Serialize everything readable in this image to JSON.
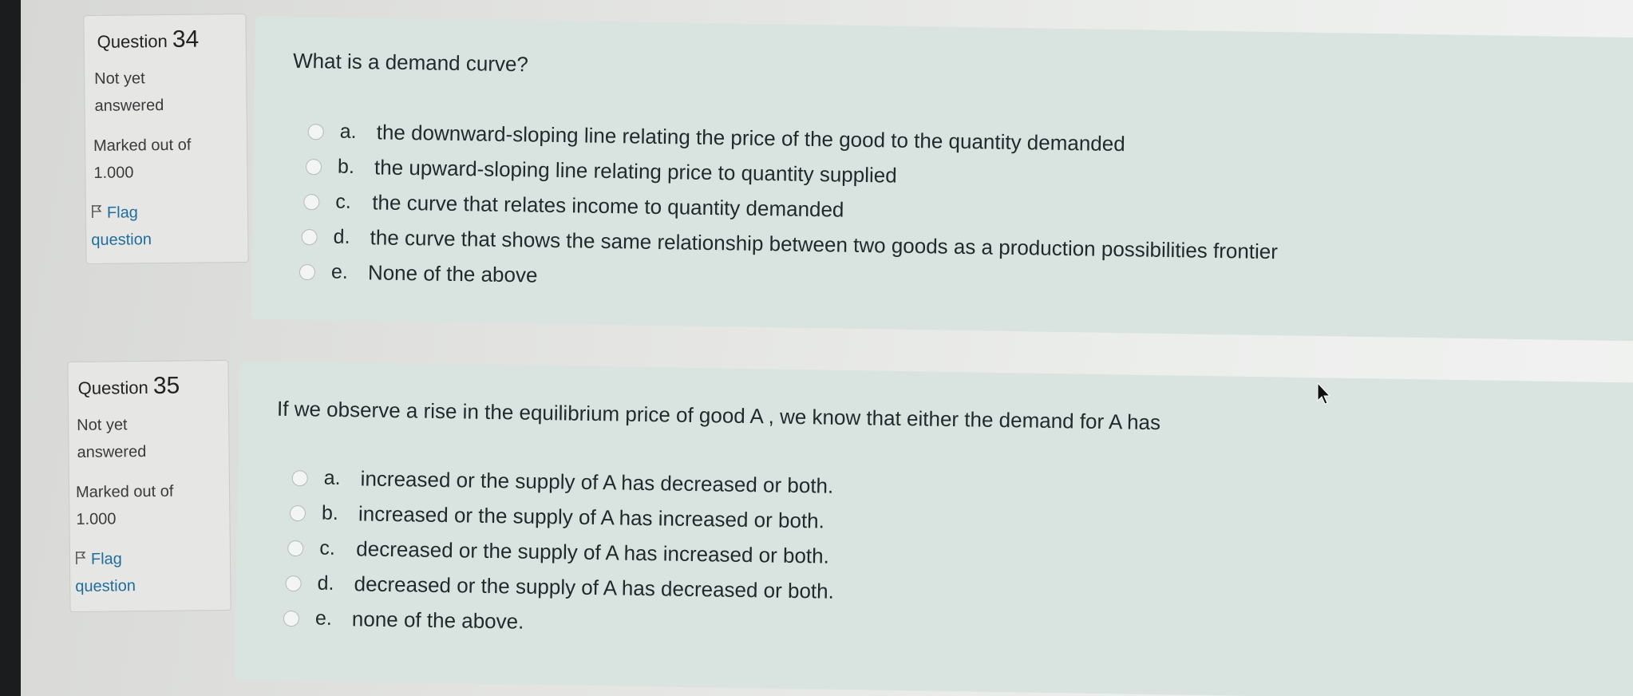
{
  "questions": [
    {
      "label": "Question",
      "number": "34",
      "status": [
        "Not yet",
        "answered"
      ],
      "marks": [
        "Marked out of",
        "1.000"
      ],
      "flag": [
        "Flag",
        "question"
      ],
      "text": "What is a demand curve?",
      "options": [
        {
          "letter": "a.",
          "text": "the downward-sloping line relating the price of the good to the quantity demanded"
        },
        {
          "letter": "b.",
          "text": "the upward-sloping line relating price to quantity supplied"
        },
        {
          "letter": "c.",
          "text": "the curve that relates income to quantity demanded"
        },
        {
          "letter": "d.",
          "text": "the curve that shows the same relationship between two goods as a production possibilities frontier"
        },
        {
          "letter": "e.",
          "text": "None of the above"
        }
      ]
    },
    {
      "label": "Question",
      "number": "35",
      "status": [
        "Not yet",
        "answered"
      ],
      "marks": [
        "Marked out of",
        "1.000"
      ],
      "flag": [
        "Flag",
        "question"
      ],
      "text": "If we observe a rise in the equilibrium price of good A , we know that either the demand for A has",
      "options": [
        {
          "letter": "a.",
          "text": "increased or the supply of A has decreased or both."
        },
        {
          "letter": "b.",
          "text": "increased or the supply of A has increased or both."
        },
        {
          "letter": "c.",
          "text": "decreased or the supply of A has increased or both."
        },
        {
          "letter": "d.",
          "text": "decreased or the supply of A has decreased or both."
        },
        {
          "letter": "e.",
          "text": "none of the above."
        }
      ]
    }
  ],
  "icons": {
    "flag": "flag-icon",
    "radio": "radio-button-icon",
    "cursor": "mouse-pointer-icon"
  }
}
